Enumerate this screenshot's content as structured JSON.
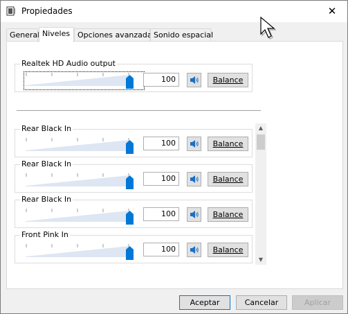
{
  "window": {
    "title": "Propiedades",
    "close_glyph": "✕"
  },
  "tabs": [
    {
      "label": "General",
      "active": false
    },
    {
      "label": "Niveles",
      "active": true
    },
    {
      "label": "Opciones avanzadas",
      "active": false
    },
    {
      "label": "Sonido espacial",
      "active": false
    }
  ],
  "main_device": {
    "name": "Realtek HD Audio output",
    "level": 100,
    "value_text": "100",
    "balance_label": "Balance",
    "speaker_icon": "speaker-icon"
  },
  "inputs": [
    {
      "name": "Rear Black In",
      "level": 100,
      "value_text": "100",
      "balance_label": "Balance"
    },
    {
      "name": "Rear Black In",
      "level": 100,
      "value_text": "100",
      "balance_label": "Balance"
    },
    {
      "name": "Rear Black In",
      "level": 100,
      "value_text": "100",
      "balance_label": "Balance"
    },
    {
      "name": "Front Pink In",
      "level": 100,
      "value_text": "100",
      "balance_label": "Balance"
    }
  ],
  "footer": {
    "accept_label": "Aceptar",
    "cancel_label": "Cancelar",
    "apply_label": "Aplicar"
  },
  "colors": {
    "accent": "#0078d7",
    "ramp": "#dde6f2",
    "thumb": "#0078d7"
  }
}
